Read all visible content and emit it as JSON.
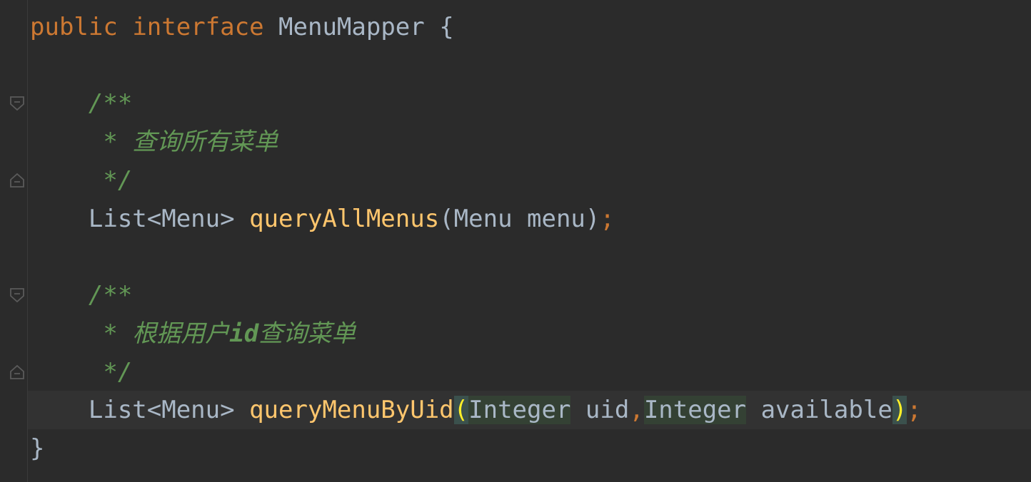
{
  "code": {
    "line1": {
      "kw_public": "public",
      "kw_interface": "interface",
      "name": "MenuMapper",
      "brace_open": "{"
    },
    "doc1": {
      "open": "/**",
      "text": " * 查询所有菜单",
      "close": " */"
    },
    "method1": {
      "return_type": "List<Menu>",
      "name": "queryAllMenus",
      "paren_open": "(",
      "params": "Menu menu",
      "paren_close": ")",
      "semi": ";"
    },
    "doc2": {
      "open": "/**",
      "star": " * ",
      "text_a": "根据用户",
      "text_id": "id",
      "text_b": "查询菜单",
      "close": " */"
    },
    "method2": {
      "return_type": "List<Menu>",
      "name": "queryMenuByUid",
      "paren_open": "(",
      "param1_type": "Integer",
      "param1_name": " uid",
      "comma": ",",
      "param2_type": "Integer",
      "param2_name": " available",
      "paren_close": ")",
      "semi": ";"
    },
    "brace_close": "}"
  },
  "colors": {
    "background": "#2b2b2b",
    "keyword": "#cc7832",
    "method": "#ffc66d",
    "comment": "#629755",
    "text": "#a9b7c6",
    "paren_highlight": "#ffef28"
  }
}
